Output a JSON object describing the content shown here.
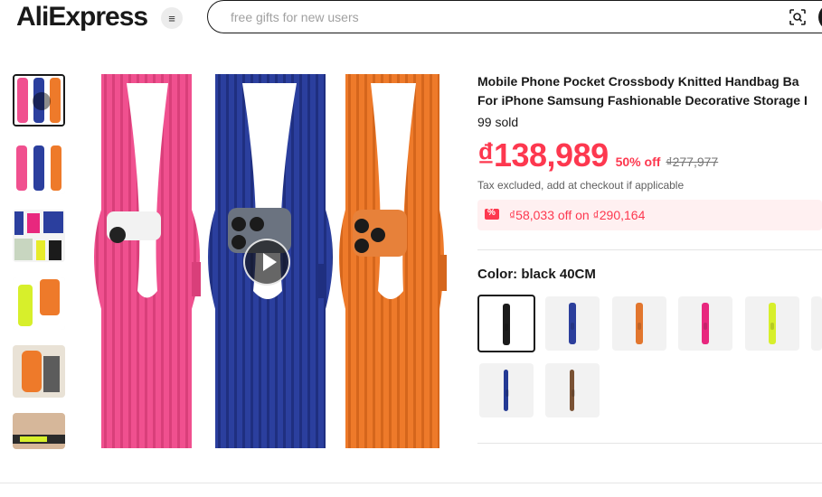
{
  "header": {
    "logo_text": "AliExpress",
    "search_placeholder": "free gifts for new users",
    "menu_icon": "hamburger-menu-icon",
    "scan_icon": "image-search-icon"
  },
  "gallery": {
    "thumbnails": [
      {
        "label": "thumbnail-video",
        "has_play": true
      },
      {
        "label": "thumbnail-2"
      },
      {
        "label": "thumbnail-3"
      },
      {
        "label": "thumbnail-4"
      },
      {
        "label": "thumbnail-5"
      },
      {
        "label": "thumbnail-6"
      }
    ],
    "play_icon": "play-icon",
    "strap_colors": [
      "#f0508f",
      "#2b3f9e",
      "#ee7a2a"
    ]
  },
  "product": {
    "title_line1": "Mobile Phone Pocket Crossbody Knitted Handbag Ba",
    "title_line2": "For iPhone Samsung Fashionable Decorative Storage I",
    "sold": "99 sold",
    "price": "₫138,989",
    "discount": "50% off",
    "original_price": "₫277,977",
    "tax_note": "Tax excluded, add at checkout if applicable",
    "coupon_text": "₫58,033 off on ₫290,164",
    "color_label": "Color: black 40CM",
    "color_options": [
      {
        "name": "black",
        "hex": "#1b1b1b",
        "selected": true
      },
      {
        "name": "blue",
        "hex": "#2c3f9c"
      },
      {
        "name": "orange",
        "hex": "#e2762e"
      },
      {
        "name": "pink",
        "hex": "#e8287e"
      },
      {
        "name": "yellow",
        "hex": "#d7ef2b"
      },
      {
        "name": "blue-thin",
        "hex": "#243a94"
      },
      {
        "name": "brown",
        "hex": "#7a5234"
      }
    ]
  },
  "colors": {
    "accent": "#fd384f",
    "coupon_bg": "#fff0f1"
  }
}
